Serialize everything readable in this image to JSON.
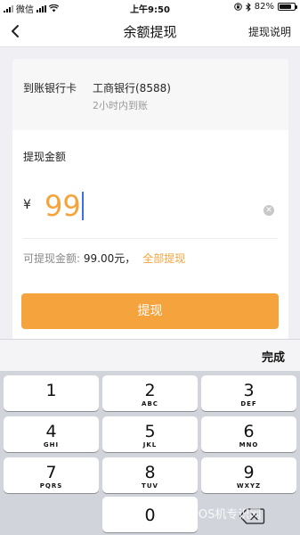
{
  "status_bar": {
    "carrier": "微信",
    "time": "上午9:50",
    "battery": "82%",
    "battery_level": 0.82
  },
  "nav": {
    "back_icon": "chevron-left-icon",
    "title": "余额提现",
    "right_action": "提现说明"
  },
  "bank": {
    "label": "到账银行卡",
    "name": "工商银行(8588)",
    "hint": "2小时内到账"
  },
  "amount": {
    "label": "提现金额",
    "currency": "¥",
    "value": "99",
    "clear_icon": "clear-icon"
  },
  "available": {
    "label": "可提现金额: ",
    "value": "99.00元，",
    "withdraw_all": "全部提现"
  },
  "submit_label": "提现",
  "keyboard": {
    "done_label": "完成",
    "keys": [
      {
        "num": "1",
        "letters": ""
      },
      {
        "num": "2",
        "letters": "ABC"
      },
      {
        "num": "3",
        "letters": "DEF"
      },
      {
        "num": "4",
        "letters": "GHI"
      },
      {
        "num": "5",
        "letters": "JKL"
      },
      {
        "num": "6",
        "letters": "MNO"
      },
      {
        "num": "7",
        "letters": "PQRS"
      },
      {
        "num": "8",
        "letters": "TUV"
      },
      {
        "num": "9",
        "letters": "WXYZ"
      },
      {
        "num": "0",
        "letters": ""
      }
    ],
    "delete_icon": "backspace-icon"
  },
  "watermark": "POS机专识网",
  "colors": {
    "accent": "#f5a33c",
    "caret": "#3b6ee8",
    "background": "#efeff4"
  }
}
